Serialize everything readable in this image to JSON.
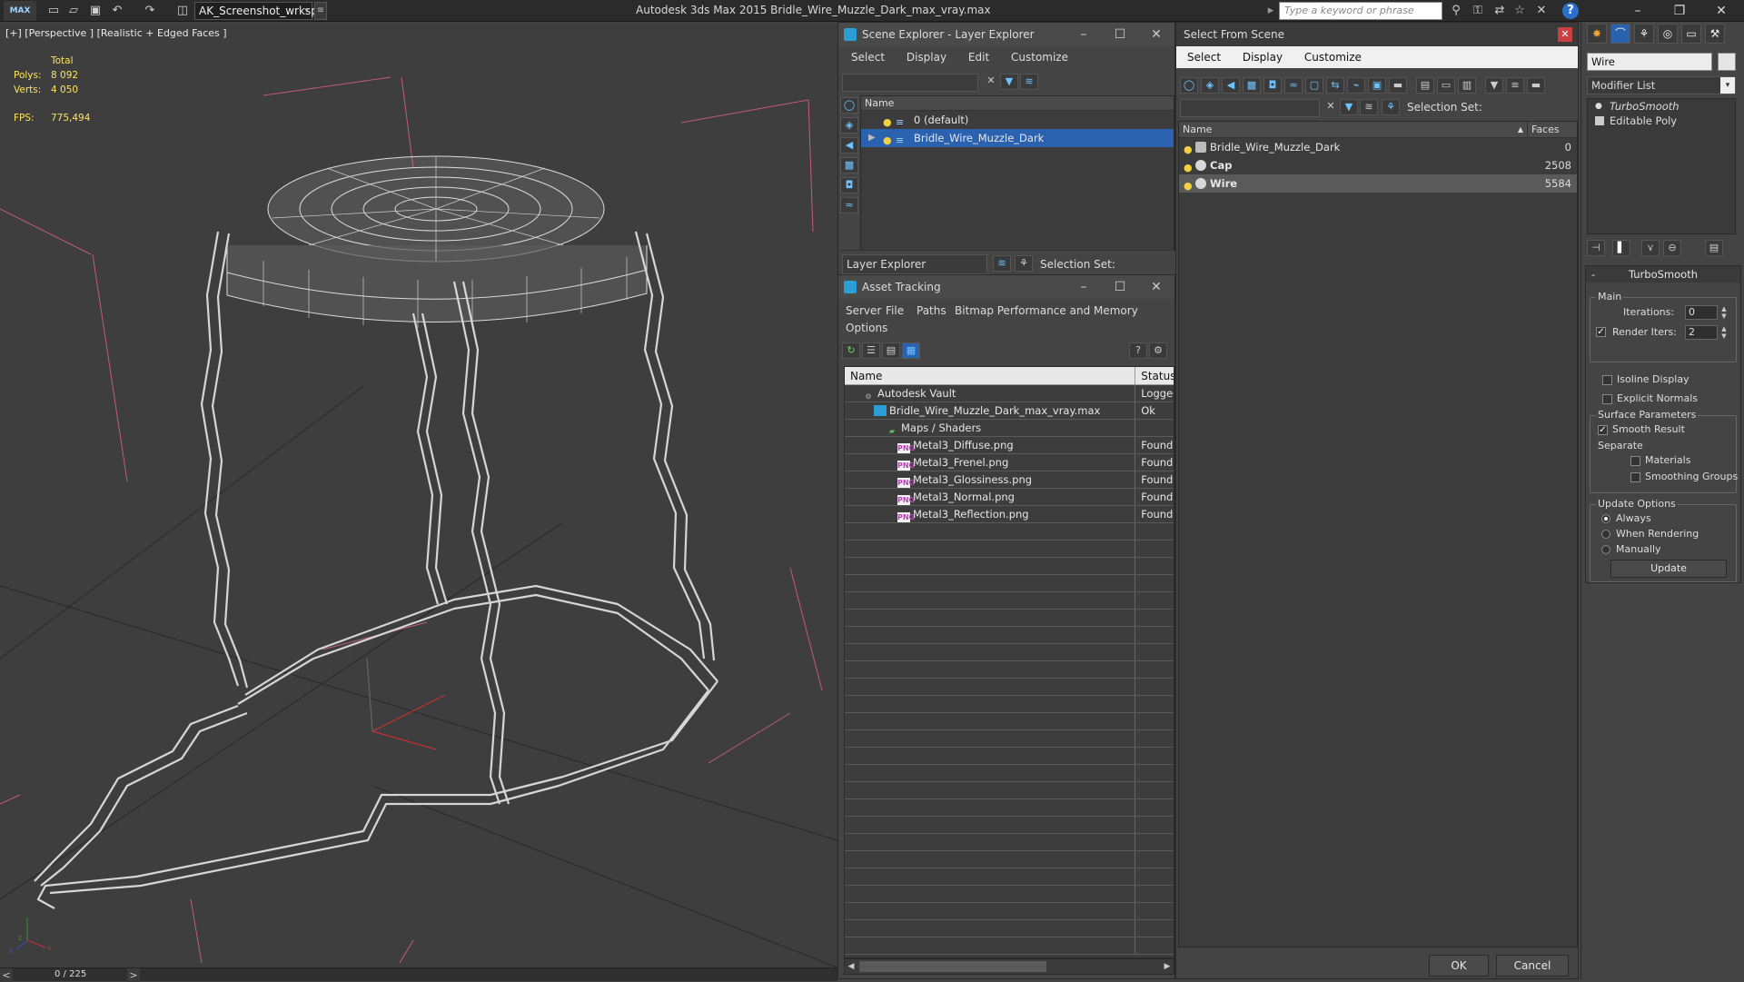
{
  "titlebar": {
    "logo": "MAX",
    "workspace": "AK_Screenshot_wrksp",
    "app_title": "Autodesk 3ds Max  2015     Bridle_Wire_Muzzle_Dark_max_vray.max",
    "search_placeholder": "Type a keyword or phrase",
    "toolbar_icons": [
      "new-file-icon",
      "open-file-icon",
      "save-icon",
      "undo-icon",
      "redo-icon",
      "project-folder-icon"
    ],
    "help_icons": [
      "binoculars-icon",
      "key-icon",
      "exchange-icon",
      "star-icon",
      "x-icon",
      "help-icon"
    ]
  },
  "viewport": {
    "label": "[+] [Perspective ] [Realistic + Edged Faces ]",
    "stats": {
      "total_label": "Total",
      "polys_label": "Polys:",
      "polys_value": "8 092",
      "verts_label": "Verts:",
      "verts_value": "4 050",
      "fps_label": "FPS:",
      "fps_value": "775,494"
    },
    "axis_labels": {
      "x": "x",
      "y": "y",
      "z": "z"
    }
  },
  "timeline": {
    "frame": "0 / 225",
    "prev": "<",
    "next": ">"
  },
  "scene_explorer": {
    "title": "Scene Explorer - Layer Explorer",
    "menu": [
      "Select",
      "Display",
      "Edit",
      "Customize"
    ],
    "column": "Name",
    "rows": [
      {
        "label": "0 (default)",
        "selected": false
      },
      {
        "label": "Bridle_Wire_Muzzle_Dark",
        "selected": true
      }
    ],
    "bottom_dropdown": "Layer Explorer",
    "selection_set_label": "Selection Set:"
  },
  "asset_tracking": {
    "title": "Asset Tracking",
    "menu_row1": [
      "Server",
      "File",
      "Paths",
      "Bitmap Performance and Memory"
    ],
    "menu_row2": [
      "Options"
    ],
    "columns": {
      "name": "Name",
      "status": "Status"
    },
    "rows": [
      {
        "name": "Autodesk Vault",
        "status": "Logged",
        "indent": 1,
        "icon": "vault-icon"
      },
      {
        "name": "Bridle_Wire_Muzzle_Dark_max_vray.max",
        "status": "Ok",
        "indent": 2,
        "icon": "max-file-icon"
      },
      {
        "name": "Maps / Shaders",
        "status": "",
        "indent": 3,
        "icon": "maps-folder-icon"
      },
      {
        "name": "Metal3_Diffuse.png",
        "status": "Found",
        "indent": 4,
        "icon": "png-icon"
      },
      {
        "name": "Metal3_Frenel.png",
        "status": "Found",
        "indent": 4,
        "icon": "png-icon"
      },
      {
        "name": "Metal3_Glossiness.png",
        "status": "Found",
        "indent": 4,
        "icon": "png-icon"
      },
      {
        "name": "Metal3_Normal.png",
        "status": "Found",
        "indent": 4,
        "icon": "png-icon"
      },
      {
        "name": "Metal3_Reflection.png",
        "status": "Found",
        "indent": 4,
        "icon": "png-icon"
      }
    ],
    "png_badge": "PNG"
  },
  "select_from_scene": {
    "title": "Select From Scene",
    "menu": [
      "Select",
      "Display",
      "Customize"
    ],
    "selection_set_label": "Selection Set:",
    "columns": {
      "name": "Name",
      "faces": "Faces"
    },
    "rows": [
      {
        "name": "Bridle_Wire_Muzzle_Dark",
        "faces": "0",
        "bold": false,
        "highlight": false
      },
      {
        "name": "Cap",
        "faces": "2508",
        "bold": true,
        "highlight": false
      },
      {
        "name": "Wire",
        "faces": "5584",
        "bold": true,
        "highlight": true
      }
    ],
    "ok": "OK",
    "cancel": "Cancel"
  },
  "command_panel": {
    "object_name": "Wire",
    "modifier_list": "Modifier List",
    "stack": [
      {
        "label": "TurboSmooth",
        "italic": true
      },
      {
        "label": "Editable Poly",
        "italic": false
      }
    ],
    "turbosmooth": {
      "title": "TurboSmooth",
      "collapse": "-",
      "main_label": "Main",
      "iterations_label": "Iterations:",
      "iterations_value": "0",
      "render_iters_label": "Render Iters:",
      "render_iters_value": "2",
      "render_iters_checked": true,
      "isoline_label": "Isoline Display",
      "isoline_checked": false,
      "explicit_normals_label": "Explicit Normals",
      "explicit_normals_checked": false,
      "surface_params_label": "Surface Parameters",
      "smooth_result_label": "Smooth Result",
      "smooth_result_checked": true,
      "separate_label": "Separate",
      "materials_label": "Materials",
      "smoothing_groups_label": "Smoothing Groups",
      "update_options_label": "Update Options",
      "always_label": "Always",
      "when_rendering_label": "When Rendering",
      "manually_label": "Manually",
      "update_selected": "Always",
      "update_button": "Update"
    }
  }
}
